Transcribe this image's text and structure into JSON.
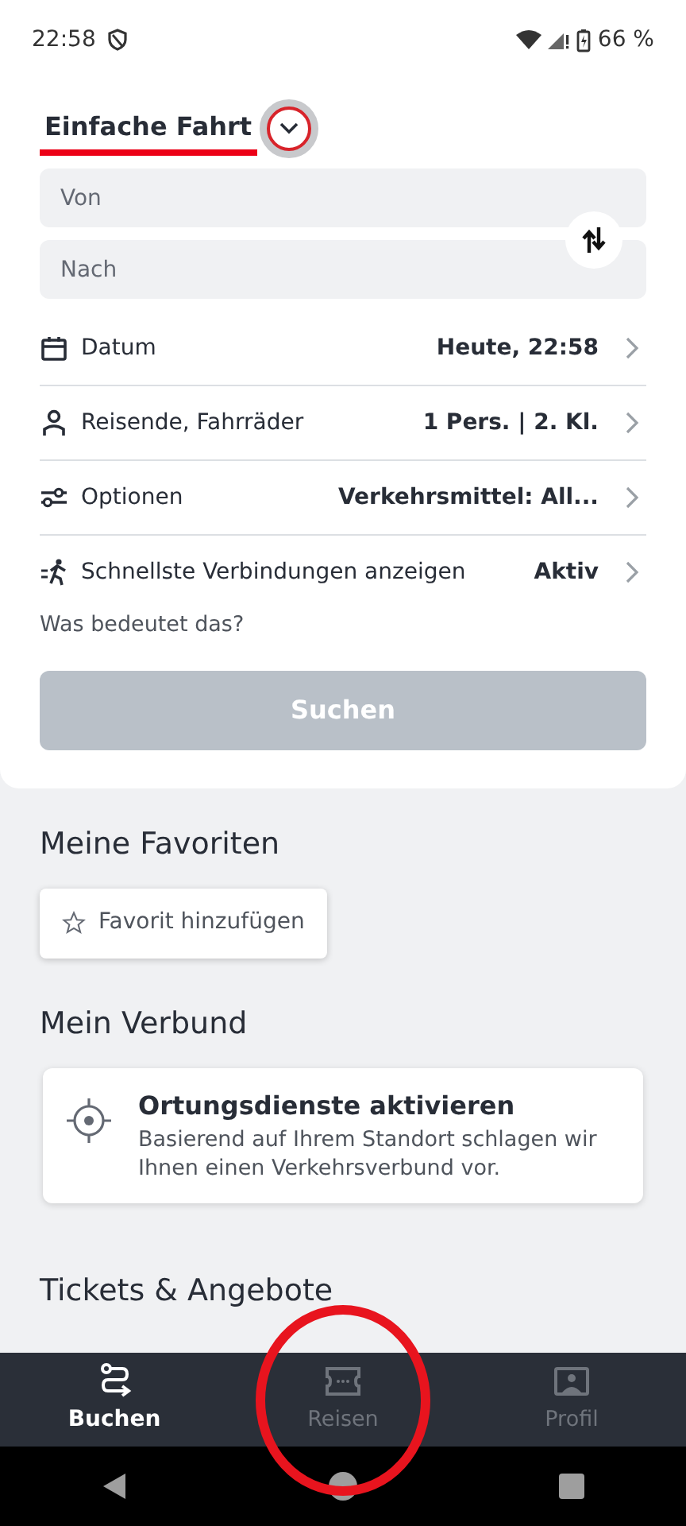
{
  "status_bar": {
    "time": "22:58",
    "battery": "66 %"
  },
  "trip_type": {
    "label": "Einfache Fahrt",
    "selected": true
  },
  "fields": [
    {
      "placeholder": "Von"
    },
    {
      "placeholder": "Nach"
    }
  ],
  "options": [
    {
      "label": "Datum",
      "value": "Heute, 22:58"
    },
    {
      "label": "Reisende, Fahrräder",
      "value": "1 Pers. | 2. Kl."
    },
    {
      "label": "Optionen",
      "value": "Verkehrsmittel: All..."
    },
    {
      "label": "Schnellste Verbindungen anzeigen",
      "value": "Aktiv"
    }
  ],
  "help_link": "Was bedeutet das?",
  "search_button": {
    "label": "Suchen",
    "disabled": true
  },
  "favorites": {
    "title": "Meine Favoriten",
    "button": "Favorit hinzufügen"
  },
  "verbund": {
    "title": "Mein Verbund",
    "card_title": "Ortungsdienste aktivieren",
    "card_text": "Basierend auf Ihrem Standort schlagen wir Ihnen einen Verkehrsverbund vor."
  },
  "tickets_title": "Tickets & Angebote",
  "bottom_nav": [
    {
      "label": "Buchen",
      "selected": true
    },
    {
      "label": "Reisen",
      "selected": false
    },
    {
      "label": "Profil",
      "selected": false
    }
  ],
  "annotations": [
    {
      "kind": "ring"
    },
    {
      "kind": "ellipse"
    }
  ]
}
